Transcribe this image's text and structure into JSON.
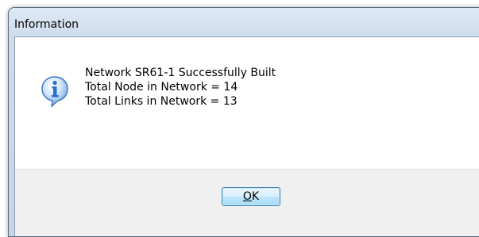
{
  "window": {
    "title": "Information"
  },
  "message": {
    "icon": "information-icon",
    "lines": [
      "Network SR61-1 Successfully Built",
      "Total Node in Network = 14",
      "Total Links in Network = 13"
    ]
  },
  "buttons": {
    "ok_mnemonic": "O",
    "ok_rest": "K"
  },
  "colors": {
    "icon_blue": "#2b6fc7",
    "button_border": "#3c7fb1"
  }
}
